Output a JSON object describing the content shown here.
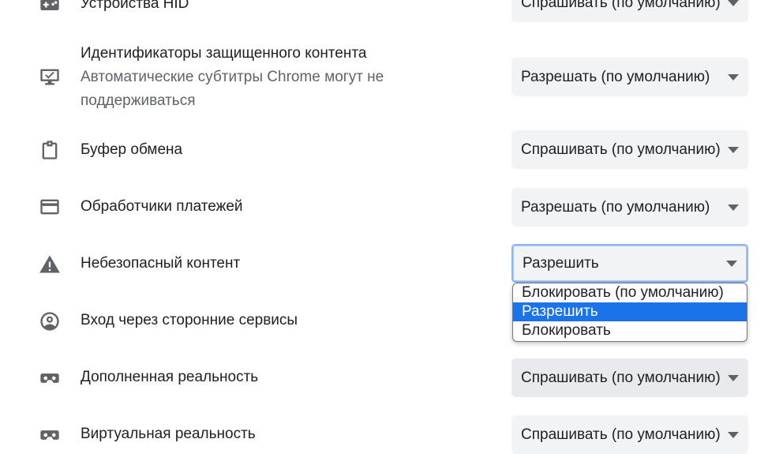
{
  "rows": [
    {
      "label": "Устройства HID",
      "value": "Спрашивать (по умолчанию)",
      "icon": "gamepad-icon"
    },
    {
      "label": "Идентификаторы защищенного контента",
      "sublabel": "Автоматические субтитры Chrome могут не поддерживаться",
      "value": "Разрешать (по умолчанию)",
      "icon": "monitor-check-icon"
    },
    {
      "label": "Буфер обмена",
      "value": "Спрашивать (по умолчанию)",
      "icon": "clipboard-icon"
    },
    {
      "label": "Обработчики платежей",
      "value": "Разрешать (по умолчанию)",
      "icon": "credit-card-icon"
    },
    {
      "label": "Небезопасный контент",
      "value": "Разрешить",
      "icon": "warning-icon"
    },
    {
      "label": "Вход через сторонние сервисы",
      "value": "",
      "icon": "account-circle-icon"
    },
    {
      "label": "Дополненная реальность",
      "value": "Спрашивать (по умолчанию)",
      "icon": "ar-headset-icon"
    },
    {
      "label": "Виртуальная реальность",
      "value": "Спрашивать (по умолчанию)",
      "icon": "vr-headset-icon"
    }
  ],
  "dropdown": {
    "options": [
      "Блокировать (по умолчанию)",
      "Разрешить",
      "Блокировать"
    ],
    "selected": "Разрешить"
  },
  "colors": {
    "accent": "#1a73e8",
    "select_bg": "#f1f3f4",
    "icon": "#5f6368"
  }
}
